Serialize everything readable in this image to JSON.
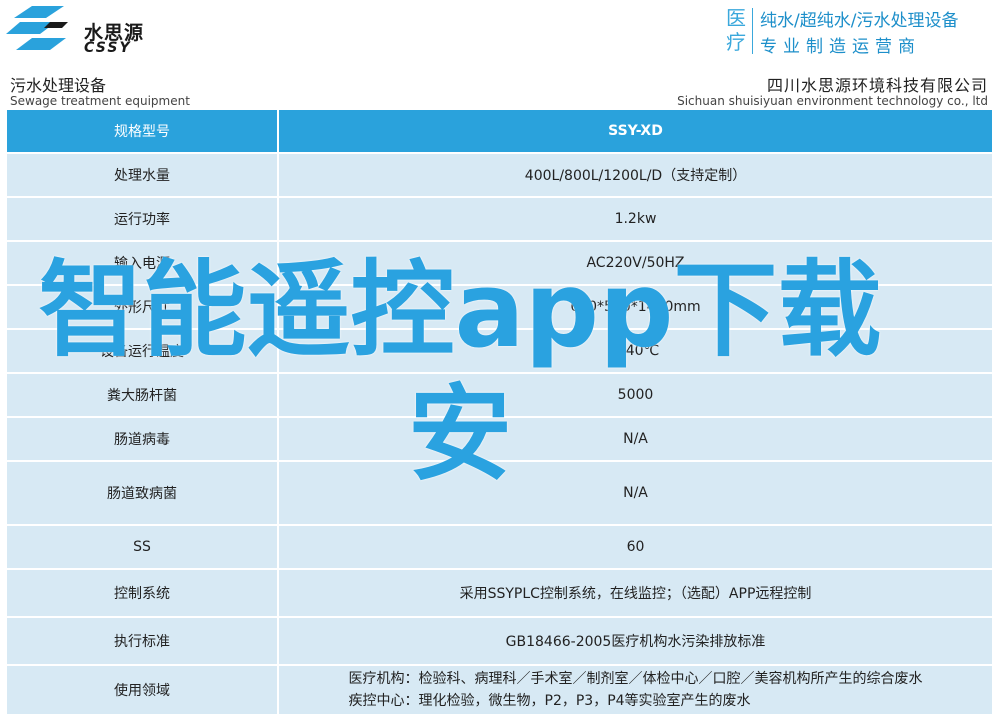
{
  "header": {
    "logo_cn": "水思源",
    "logo_en": "CSSY",
    "brand_side": "医疗",
    "brand_line1": "纯水/超纯水/污水处理设备",
    "brand_line2": "专业制造运营商"
  },
  "subheader": {
    "left_cn": "污水处理设备",
    "left_en": "Sewage treatment equipment",
    "right_cn": "四川水思源环境科技有限公司",
    "right_en": "Sichuan shuisiyuan environment technology co., ltd"
  },
  "table": {
    "rows": [
      {
        "key": "规格型号",
        "value": "SSY-XD"
      },
      {
        "key": "处理水量",
        "value": "400L/800L/1200L/D（支持定制）"
      },
      {
        "key": "运行功率",
        "value": "1.2kw"
      },
      {
        "key": "输入电源",
        "value": "AC220V/50HZ"
      },
      {
        "key": "外形尺寸",
        "value": "680*560*1440mm"
      },
      {
        "key": "设备运行温度",
        "value": "5-40℃"
      },
      {
        "key": "粪大肠杆菌",
        "value": "5000"
      },
      {
        "key": "肠道病毒",
        "value": "N/A"
      },
      {
        "key": "肠道致病菌",
        "value": "N/A"
      },
      {
        "key": "SS",
        "value": "60"
      },
      {
        "key": "控制系统",
        "value": "采用SSYPLC控制系统，在线监控；（选配）APP远程控制"
      },
      {
        "key": "执行标准",
        "value": "GB18466-2005医疗机构水污染排放标准"
      },
      {
        "key": "使用领域",
        "value_line1": "医疗机构：检验科、病理科／手术室／制剂室／体检中心／口腔／美容机构所产生的综合废水",
        "value_line2": "疾控中心：理化检验，微生物，P2，P3，P4等实验室产生的废水"
      }
    ]
  },
  "overlay": {
    "text": "智能遥控app下载安"
  },
  "colors": {
    "accent": "#2aa2dc",
    "row_bg": "#d7e9f4",
    "overlay": "#2aa2e0"
  }
}
